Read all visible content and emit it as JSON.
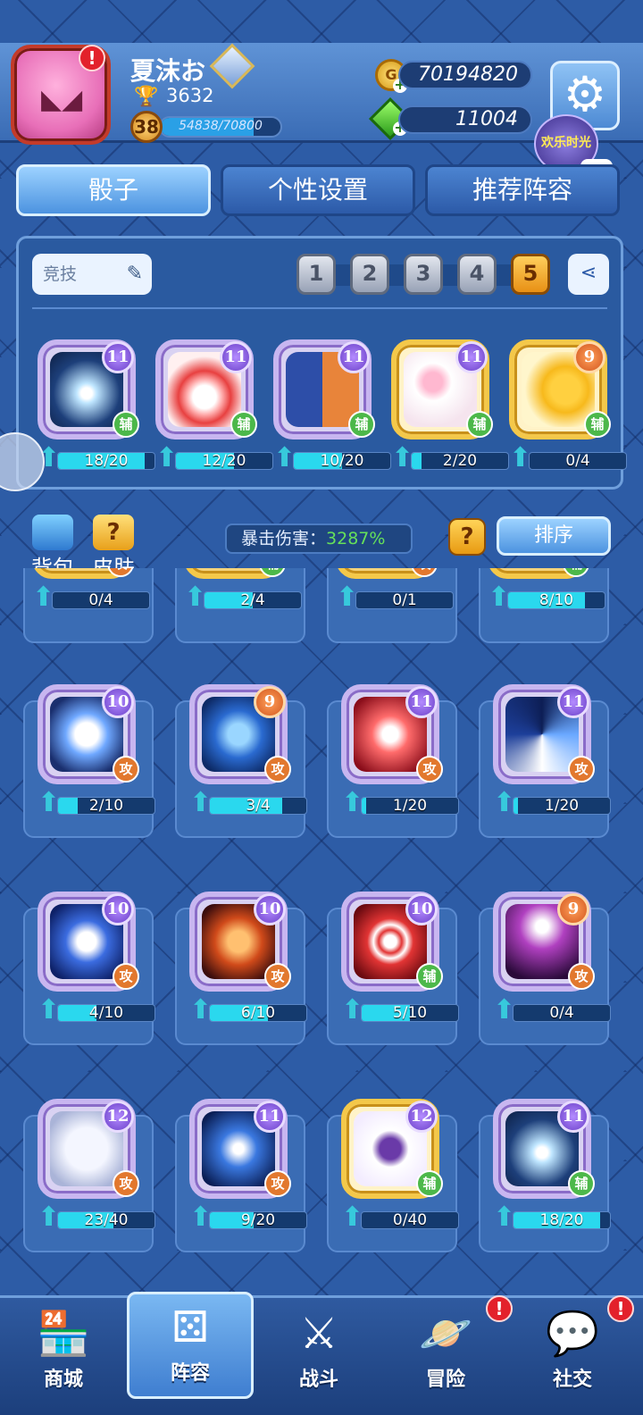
{
  "profile": {
    "name": "夏沫お",
    "trophies": "3632",
    "level": "38",
    "xp": "54838/70800",
    "xp_fraction": 0.774
  },
  "currency": {
    "gold": "70194820",
    "gems": "11004"
  },
  "event_badge": "欢乐时光",
  "tabs": [
    {
      "label": "骰子"
    },
    {
      "label": "个性设置"
    },
    {
      "label": "推荐阵容"
    }
  ],
  "deck": {
    "mode": "竞技",
    "slots": [
      "1",
      "2",
      "3",
      "4",
      "5"
    ],
    "active_slot": "5",
    "dice": [
      {
        "level": "11",
        "type": "辅",
        "progress": "18/20",
        "fill": 0.9,
        "gold": false,
        "art": "dandelion"
      },
      {
        "level": "11",
        "type": "辅",
        "progress": "12/20",
        "fill": 0.6,
        "gold": false,
        "art": "red-drum"
      },
      {
        "level": "11",
        "type": "辅",
        "progress": "10/20",
        "fill": 0.5,
        "gold": false,
        "art": "twin-figure"
      },
      {
        "level": "11",
        "type": "辅",
        "progress": "2/20",
        "fill": 0.1,
        "gold": true,
        "art": "cherry-blossom"
      },
      {
        "level": "9",
        "type": "辅",
        "progress": "0/4",
        "fill": 0.0,
        "gold": true,
        "art": "gold-coin"
      }
    ]
  },
  "toolbar": {
    "bag": "背包",
    "skin": "皮肤",
    "crit_label": "暴击伤害：",
    "crit_value": "3287%",
    "help": "?",
    "sort": "排序"
  },
  "collection": {
    "partial_row": [
      {
        "type": "攻",
        "progress": "0/4",
        "fill": 0.0
      },
      {
        "type": "辅",
        "progress": "2/4",
        "fill": 0.5
      },
      {
        "type": "攻",
        "progress": "0/1",
        "fill": 0.0
      },
      {
        "type": "辅",
        "progress": "8/10",
        "fill": 0.8
      }
    ],
    "rows": [
      [
        {
          "level": "10",
          "type": "攻",
          "progress": "2/10",
          "fill": 0.2,
          "gold": false,
          "art": "fairy"
        },
        {
          "level": "9",
          "type": "攻",
          "progress": "3/4",
          "fill": 0.75,
          "gold": false,
          "art": "lion"
        },
        {
          "level": "11",
          "type": "攻",
          "progress": "1/20",
          "fill": 0.05,
          "gold": false,
          "art": "crab"
        },
        {
          "level": "11",
          "type": "攻",
          "progress": "1/20",
          "fill": 0.05,
          "gold": false,
          "art": "vortex"
        }
      ],
      [
        {
          "level": "10",
          "type": "攻",
          "progress": "4/10",
          "fill": 0.4,
          "gold": false,
          "art": "aquarius"
        },
        {
          "level": "10",
          "type": "攻",
          "progress": "6/10",
          "fill": 0.6,
          "gold": false,
          "art": "tiger"
        },
        {
          "level": "10",
          "type": "辅",
          "progress": "5/10",
          "fill": 0.5,
          "gold": false,
          "art": "shield-s"
        },
        {
          "level": "9",
          "type": "攻",
          "progress": "0/4",
          "fill": 0.0,
          "gold": false,
          "art": "shadow"
        }
      ],
      [
        {
          "level": "12",
          "type": "攻",
          "progress": "23/40",
          "fill": 0.575,
          "gold": false,
          "art": "archer"
        },
        {
          "level": "11",
          "type": "攻",
          "progress": "9/20",
          "fill": 0.45,
          "gold": false,
          "art": "scorpion"
        },
        {
          "level": "12",
          "type": "辅",
          "progress": "0/40",
          "fill": 0.0,
          "gold": true,
          "art": "witch-hat"
        },
        {
          "level": "11",
          "type": "辅",
          "progress": "18/20",
          "fill": 0.9,
          "gold": false,
          "art": "dandelion"
        }
      ]
    ]
  },
  "nav": [
    {
      "label": "商城",
      "icon": "shop-icon",
      "glyph": "🏪",
      "alert": false,
      "active": false
    },
    {
      "label": "阵容",
      "icon": "dice-icon",
      "glyph": "⚄",
      "alert": false,
      "active": true
    },
    {
      "label": "战斗",
      "icon": "crossed-swords-icon",
      "glyph": "⚔",
      "alert": false,
      "active": false
    },
    {
      "label": "冒险",
      "icon": "planet-icon",
      "glyph": "🪐",
      "alert": true,
      "active": false
    },
    {
      "label": "社交",
      "icon": "chat-bubbles-icon",
      "glyph": "💬",
      "alert": true,
      "active": false
    }
  ],
  "colors": {
    "background": "#2d5ca6",
    "active_tab": "#9cd2ff",
    "active_slot": "#ffcf5c",
    "attack_badge": "#e2782e",
    "support_badge": "#4cb84a",
    "crit_value": "#66e05a",
    "alert": "#e3212b"
  }
}
